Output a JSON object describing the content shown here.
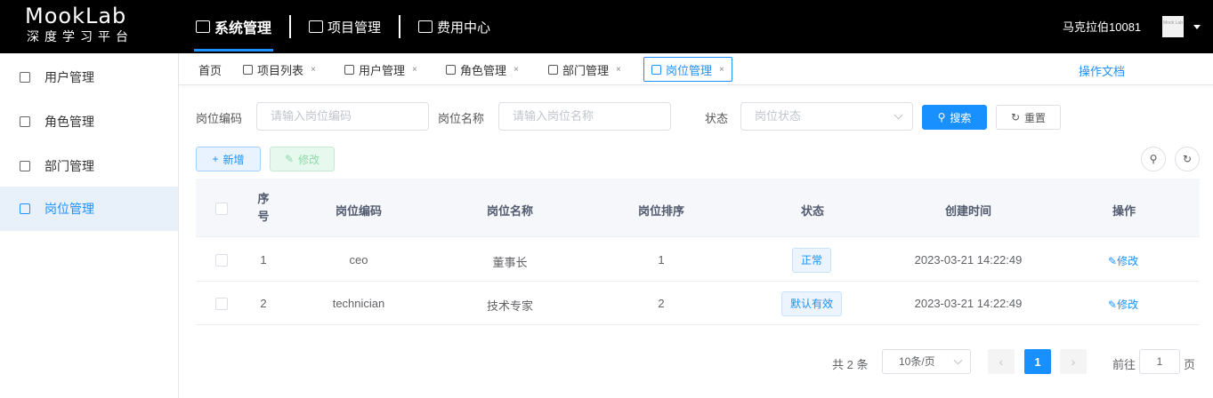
{
  "header": {
    "logo_title": "MookLab",
    "logo_subtitle": "深度学习平台",
    "nav": [
      {
        "label": "系统管理",
        "active": true
      },
      {
        "label": "项目管理",
        "active": false
      },
      {
        "label": "费用中心",
        "active": false
      }
    ],
    "username": "马克拉伯10081",
    "avatar_text": "Mook Lab"
  },
  "sidebar": {
    "items": [
      {
        "label": "用户管理",
        "icon": "users-icon"
      },
      {
        "label": "角色管理",
        "icon": "role-icon"
      },
      {
        "label": "部门管理",
        "icon": "org-icon"
      },
      {
        "label": "岗位管理",
        "icon": "post-icon",
        "active": true
      }
    ]
  },
  "tabs": {
    "items": [
      {
        "label": "首页"
      },
      {
        "label": "项目列表"
      },
      {
        "label": "用户管理"
      },
      {
        "label": "角色管理"
      },
      {
        "label": "部门管理"
      },
      {
        "label": "岗位管理",
        "active": true
      }
    ],
    "close": "×",
    "doc_link": "操作文档"
  },
  "search": {
    "code_label": "岗位编码",
    "code_placeholder": "请输入岗位编码",
    "name_label": "岗位名称",
    "name_placeholder": "请输入岗位名称",
    "status_label": "状态",
    "status_placeholder": "岗位状态",
    "search_btn": "搜索",
    "reset_btn": "重置"
  },
  "toolbar": {
    "add_btn": "新增",
    "edit_btn": "修改"
  },
  "table": {
    "columns": {
      "index_line1": "序",
      "index_line2": "号",
      "code": "岗位编码",
      "name": "岗位名称",
      "sort": "岗位排序",
      "status": "状态",
      "created": "创建时间",
      "action": "操作"
    },
    "rows": [
      {
        "index": "1",
        "code": "ceo",
        "name": "董事长",
        "sort": "1",
        "status": "正常",
        "created": "2023-03-21 14:22:49",
        "action": "修改"
      },
      {
        "index": "2",
        "code": "technician",
        "name": "技术专家",
        "sort": "2",
        "status": "默认有效",
        "created": "2023-03-21 14:22:49",
        "action": "修改"
      }
    ]
  },
  "pagination": {
    "total": "共 2 条",
    "page_size": "10条/页",
    "current": "1",
    "goto_prefix": "前往",
    "goto_value": "1",
    "goto_suffix": "页"
  },
  "colors": {
    "primary": "#1890ff",
    "topbar": "#000000",
    "active_bg": "#e8f0fa"
  }
}
